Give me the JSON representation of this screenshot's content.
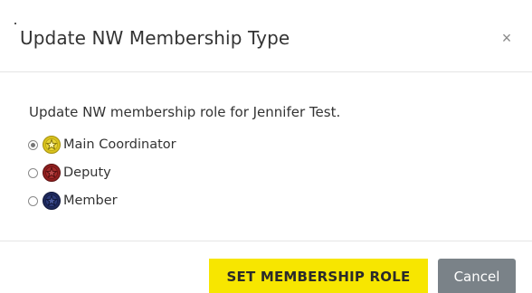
{
  "modal": {
    "title": "Update NW Membership Type",
    "close_label": "×",
    "prompt": "Update NW membership role for Jennifer Test."
  },
  "options": [
    {
      "label": "Main Coordinator",
      "selected": true,
      "badge_icon": "star-badge-icon",
      "badge_color": "#d9c21e"
    },
    {
      "label": "Deputy",
      "selected": false,
      "badge_icon": "star-badge-icon",
      "badge_color": "#8f1f1f"
    },
    {
      "label": "Member",
      "selected": false,
      "badge_icon": "star-badge-icon",
      "badge_color": "#1f2a5c"
    }
  ],
  "footer": {
    "primary_label": "SET MEMBERSHIP ROLE",
    "cancel_label": "Cancel"
  },
  "colors": {
    "primary_button": "#f7e600",
    "cancel_button": "#7a8288"
  }
}
